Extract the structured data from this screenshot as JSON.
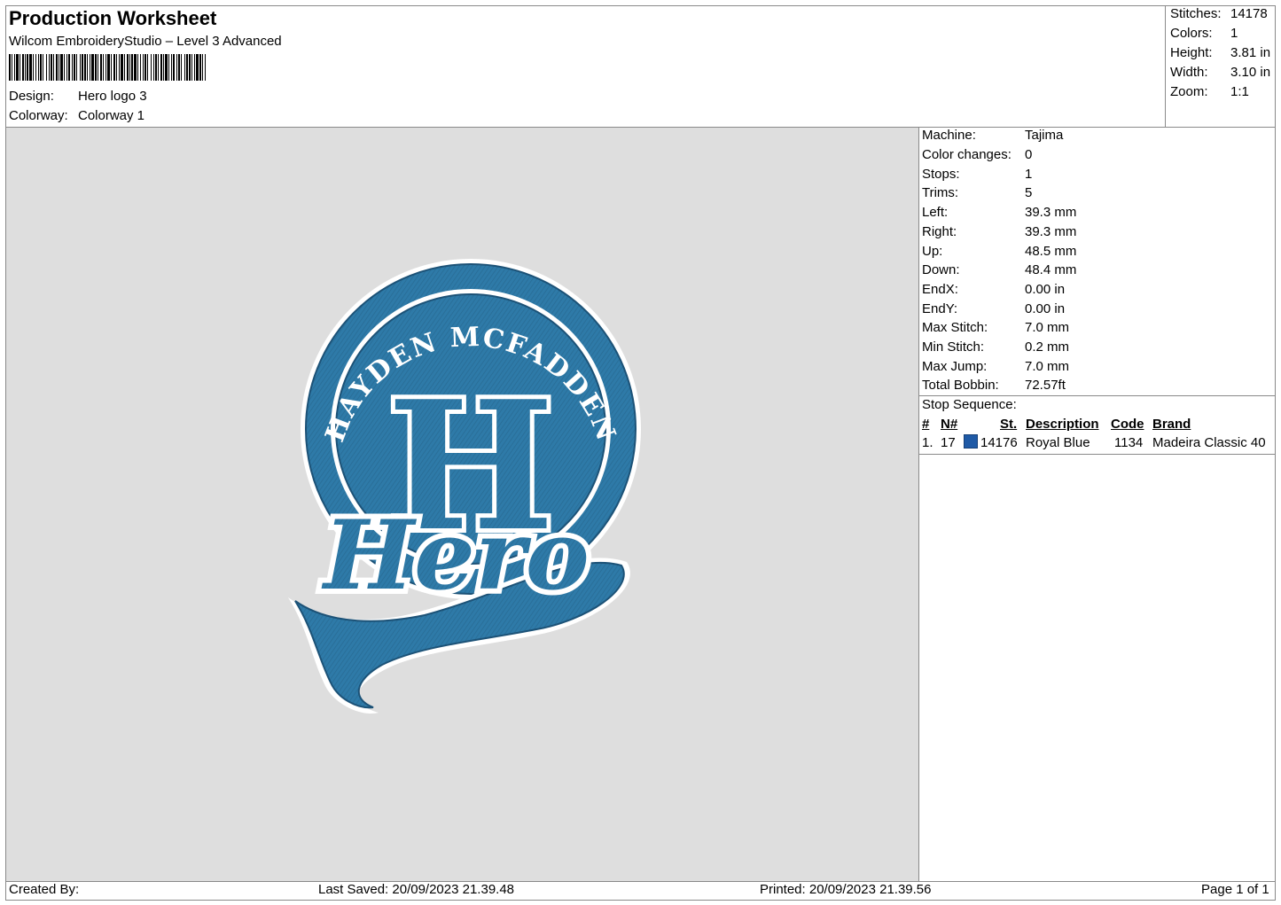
{
  "header": {
    "title": "Production Worksheet",
    "subtitle": "Wilcom EmbroideryStudio – Level 3 Advanced",
    "design_label": "Design:",
    "design_value": "Hero logo 3",
    "colorway_label": "Colorway:",
    "colorway_value": "Colorway 1"
  },
  "stats": [
    {
      "label": "Stitches:",
      "value": "14178"
    },
    {
      "label": "Colors:",
      "value": "1"
    },
    {
      "label": "Height:",
      "value": "3.81 in"
    },
    {
      "label": "Width:",
      "value": "3.10 in"
    },
    {
      "label": "Zoom:",
      "value": "1:1"
    }
  ],
  "machine_info": [
    {
      "label": "Machine:",
      "value": "Tajima"
    },
    {
      "label": "Color changes:",
      "value": "0"
    },
    {
      "label": "Stops:",
      "value": "1"
    },
    {
      "label": "Trims:",
      "value": "5"
    },
    {
      "label": "Left:",
      "value": "39.3 mm"
    },
    {
      "label": "Right:",
      "value": "39.3 mm"
    },
    {
      "label": "Up:",
      "value": "48.5 mm"
    },
    {
      "label": "Down:",
      "value": "48.4 mm"
    },
    {
      "label": "EndX:",
      "value": "0.00 in"
    },
    {
      "label": "EndY:",
      "value": "0.00 in"
    },
    {
      "label": "Max Stitch:",
      "value": "7.0 mm"
    },
    {
      "label": "Min Stitch:",
      "value": "0.2 mm"
    },
    {
      "label": "Max Jump:",
      "value": "7.0 mm"
    },
    {
      "label": "Total Bobbin:",
      "value": "72.57ft"
    }
  ],
  "stop_sequence": {
    "title": "Stop Sequence:",
    "headers": {
      "num": "#",
      "n": "N#",
      "st": "St.",
      "description": "Description",
      "code": "Code",
      "brand": "Brand"
    },
    "rows": [
      {
        "num": "1.",
        "n": "17",
        "swatch_color": "#1f5aa6",
        "st": "14176",
        "description": "Royal Blue",
        "code": "1134",
        "brand": "Madeira Classic 40"
      }
    ]
  },
  "design_art": {
    "arc_text": "HAYDEN MCFADDEN",
    "monogram": "H",
    "script_text": "Hero",
    "thread_color": "#2e7aa8",
    "outline_color": "#1c5277"
  },
  "footer": {
    "created_by": "Created By:",
    "last_saved": "Last Saved: 20/09/2023 21.39.48",
    "printed": "Printed: 20/09/2023 21.39.56",
    "page": "Page 1 of 1"
  }
}
